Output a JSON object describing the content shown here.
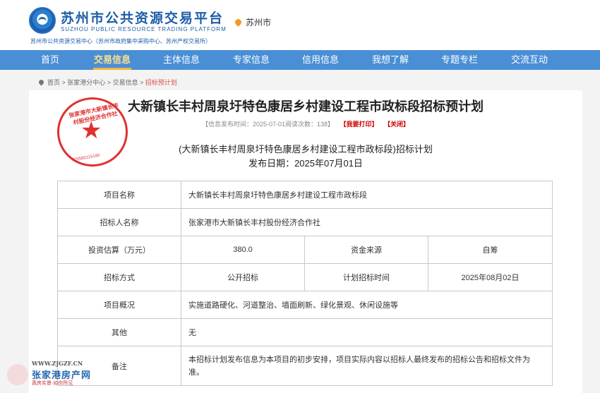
{
  "header": {
    "title": "苏州市公共资源交易平台",
    "title_en": "SUZHOU PUBLIC RESOURCE TRADING PLATFORM",
    "subtitle": "苏州市公共资源交易中心（苏州市政府集中采购中心、苏州产权交易所）",
    "location": "苏州市"
  },
  "nav": {
    "items": [
      "首页",
      "交易信息",
      "主体信息",
      "专家信息",
      "信用信息",
      "我想了解",
      "专题专栏",
      "交流互动"
    ],
    "active": "交易信息"
  },
  "breadcrumb": [
    "首页",
    "张家港分中心",
    "交易信息",
    "招标预计划"
  ],
  "article": {
    "title": "大新镇长丰村周泉圩特色康居乡村建设工程市政标段招标预计划",
    "meta": "【信息发布时间：2025-07-01阅读次数：138】",
    "print_label": "【我要打印】",
    "close_label": "【关闭】",
    "seal_text": "张家港市大新镇长丰村股份经济合作社",
    "seal_number": "320582115190",
    "sub_title": "(大新镇长丰村周泉圩特色康居乡村建设工程市政标段)招标计划",
    "publish_date": "发布日期：2025年07月01日"
  },
  "table": {
    "project_name_label": "项目名称",
    "project_name": "大新镇长丰村周泉圩特色康居乡村建设工程市政标段",
    "tenderer_label": "招标人名称",
    "tenderer": "张家港市大新镇长丰村股份经济合作社",
    "investment_label": "投资估算（万元）",
    "investment": "380.0",
    "fund_source_label": "资金来源",
    "fund_source": "自筹",
    "method_label": "招标方式",
    "method": "公开招标",
    "plan_time_label": "计划招标时间",
    "plan_time": "2025年08月02日",
    "overview_label": "项目概况",
    "overview": "实施道路硬化、河道整治、墙面刷新、绿化景观、休闲设施等",
    "other_label": "其他",
    "other": "无",
    "remark_label": "备注",
    "remark": "本招标计划发布信息为本项目的初步安排，项目实际内容以招标人最终发布的招标公告和招标文件为准。"
  },
  "watermark": {
    "url": "WWW.ZJGZF.CN",
    "name": "张家港房产网",
    "slogan": "真房实景·如你所见"
  }
}
